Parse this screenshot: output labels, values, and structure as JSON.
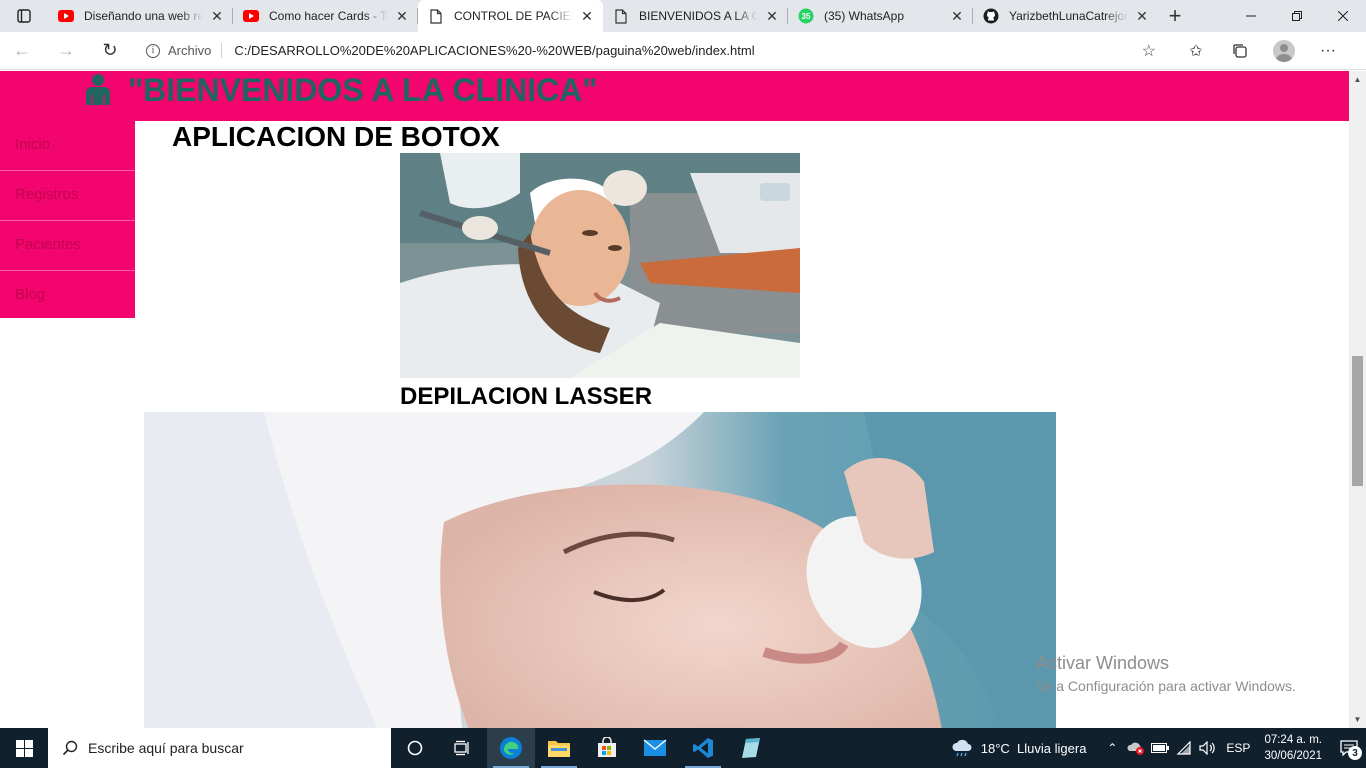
{
  "browser": {
    "tabs": [
      {
        "title": "Diseñando una web re",
        "icon": "youtube-icon",
        "active": false
      },
      {
        "title": "Como hacer Cards - Ta",
        "icon": "youtube-icon",
        "active": false
      },
      {
        "title": "CONTROL DE PACIENT",
        "icon": "file-icon",
        "active": true
      },
      {
        "title": "BIENVENIDOS A LA CL",
        "icon": "file-icon",
        "active": false
      },
      {
        "title": "(35) WhatsApp",
        "icon": "whatsapp-icon",
        "active": false
      },
      {
        "title": "YarizbethLunaCatrejon",
        "icon": "github-icon",
        "active": false
      }
    ],
    "whatsapp_count": "35",
    "address": {
      "security_label": "Archivo",
      "url": "C:/DESARROLLO%20DE%20APLICACIONES%20-%20WEB/paguina%20web/index.html"
    }
  },
  "page": {
    "header_title": "\"BIENVENIDOS A LA CLINICA\"",
    "sidebar": {
      "items": [
        {
          "label": "Inicio"
        },
        {
          "label": "Registros"
        },
        {
          "label": "Pacientes"
        },
        {
          "label": "Blog"
        }
      ]
    },
    "sections": [
      {
        "title": "APLICACION DE BOTOX",
        "image": "botox-treatment-photo"
      },
      {
        "title": "DEPILACION LASSER",
        "image": "laser-treatment-photo"
      }
    ],
    "colors": {
      "header_bg": "#f2056f",
      "title_color": "#20655f",
      "sidebar_text": "#c3054f"
    }
  },
  "watermark": {
    "line1": "Activar Windows",
    "line2": "Ve a Configuración para activar Windows."
  },
  "taskbar": {
    "search_placeholder": "Escribe aquí para buscar",
    "weather": {
      "temp": "18°C",
      "desc": "Lluvia ligera"
    },
    "language": "ESP",
    "time": "07:24 a. m.",
    "date": "30/06/2021",
    "notifications": "3"
  }
}
